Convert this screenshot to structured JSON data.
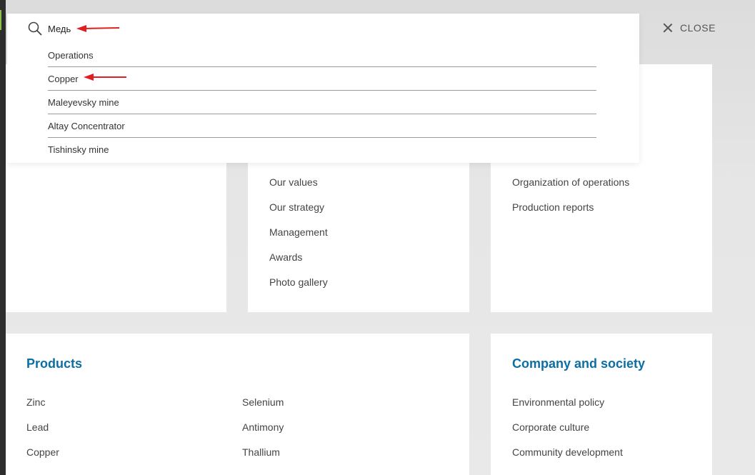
{
  "search": {
    "value": "Медь",
    "placeholder": "",
    "suggestions": [
      {
        "label": "Operations"
      },
      {
        "label": "Copper"
      },
      {
        "label": "Maleyevsky mine"
      },
      {
        "label": "Altay Concentrator"
      },
      {
        "label": "Tishinsky mine"
      }
    ]
  },
  "close": {
    "label": "CLOSE"
  },
  "about": {
    "links": [
      "Our values",
      "Our strategy",
      "Management",
      "Awards",
      "Photo gallery"
    ]
  },
  "operations": {
    "links": [
      "Organization of operations",
      "Production reports"
    ]
  },
  "products": {
    "title": "Products",
    "col1": [
      "Zinc",
      "Lead",
      "Copper"
    ],
    "col2": [
      "Selenium",
      "Antimony",
      "Thallium"
    ]
  },
  "company": {
    "title": "Company and society",
    "links": [
      "Environmental policy",
      "Corporate culture",
      "Community development"
    ]
  },
  "colors": {
    "heading": "#0b6fa4",
    "annotation_arrow": "#e02020"
  }
}
